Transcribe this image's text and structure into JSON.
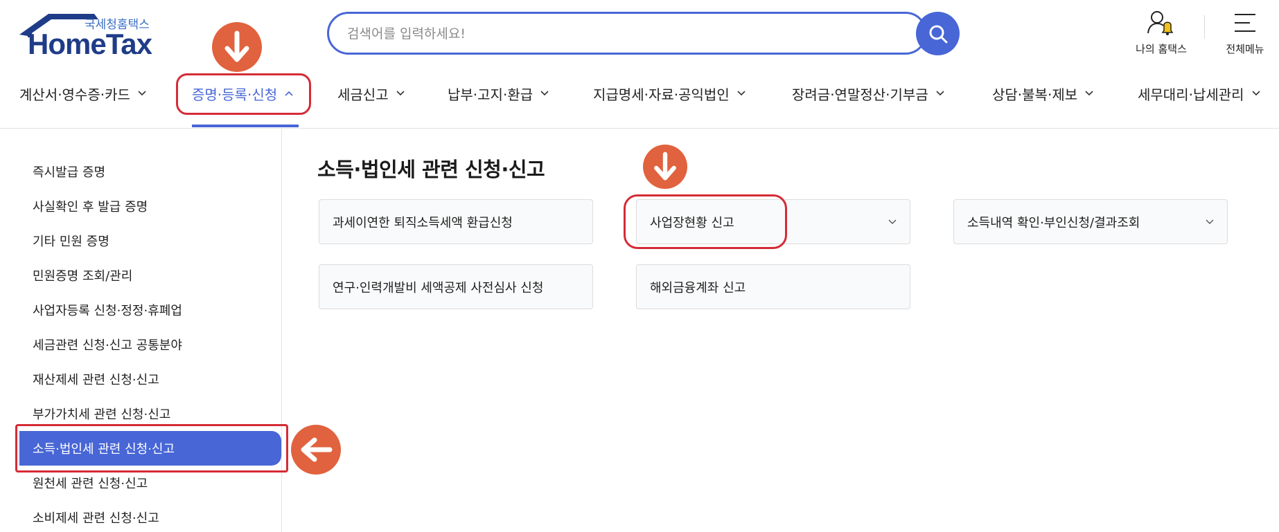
{
  "header": {
    "logo_sub": "국세청홈택스",
    "logo_main": "HomeTax",
    "search_placeholder": "검색어를 입력하세요!",
    "my_hometax_label": "나의 홈택스",
    "all_menu_label": "전체메뉴"
  },
  "nav": {
    "items": [
      {
        "label": "계산서·영수증·카드",
        "active": false
      },
      {
        "label": "증명·등록·신청",
        "active": true
      },
      {
        "label": "세금신고",
        "active": false
      },
      {
        "label": "납부·고지·환급",
        "active": false
      },
      {
        "label": "지급명세·자료·공익법인",
        "active": false
      },
      {
        "label": "장려금·연말정산·기부금",
        "active": false
      },
      {
        "label": "상담·불복·제보",
        "active": false
      },
      {
        "label": "세무대리·납세관리",
        "active": false
      }
    ]
  },
  "sidebar": {
    "items": [
      {
        "label": "즉시발급 증명",
        "active": false
      },
      {
        "label": "사실확인 후 발급 증명",
        "active": false
      },
      {
        "label": "기타 민원 증명",
        "active": false
      },
      {
        "label": "민원증명 조회/관리",
        "active": false
      },
      {
        "label": "사업자등록 신청·정정·휴폐업",
        "active": false
      },
      {
        "label": "세금관련 신청·신고 공통분야",
        "active": false
      },
      {
        "label": "재산제세 관련 신청·신고",
        "active": false
      },
      {
        "label": "부가가치세 관련 신청·신고",
        "active": false
      },
      {
        "label": "소득·법인세 관련 신청·신고",
        "active": true
      },
      {
        "label": "원천세 관련 신청·신고",
        "active": false
      },
      {
        "label": "소비제세 관련 신청·신고",
        "active": false
      }
    ]
  },
  "main": {
    "title": "소득·법인세 관련 신청·신고",
    "cards": [
      {
        "label": "과세이연한 퇴직소득세액 환급신청",
        "expandable": false
      },
      {
        "label": "사업장현황 신고",
        "expandable": true
      },
      {
        "label": "소득내역 확인·부인신청/결과조회",
        "expandable": true
      },
      {
        "label": "연구·인력개발비 세액공제 사전심사 신청",
        "expandable": false
      },
      {
        "label": "해외금융계좌 신고",
        "expandable": false
      }
    ]
  },
  "colors": {
    "accent": "#4866d6",
    "logo_blue": "#1f3c88",
    "annotation_red": "#d52b36",
    "annotation_orange": "#e1623e",
    "bell_yellow": "#f2c21a"
  },
  "icons": {
    "search": "search-icon",
    "user": "user-icon",
    "bell": "bell-icon",
    "menu": "hamburger-icon",
    "chevron_down": "chevron-down-icon",
    "chevron_up": "chevron-up-icon",
    "arrow_down": "arrow-down-icon",
    "arrow_left": "arrow-left-icon"
  }
}
